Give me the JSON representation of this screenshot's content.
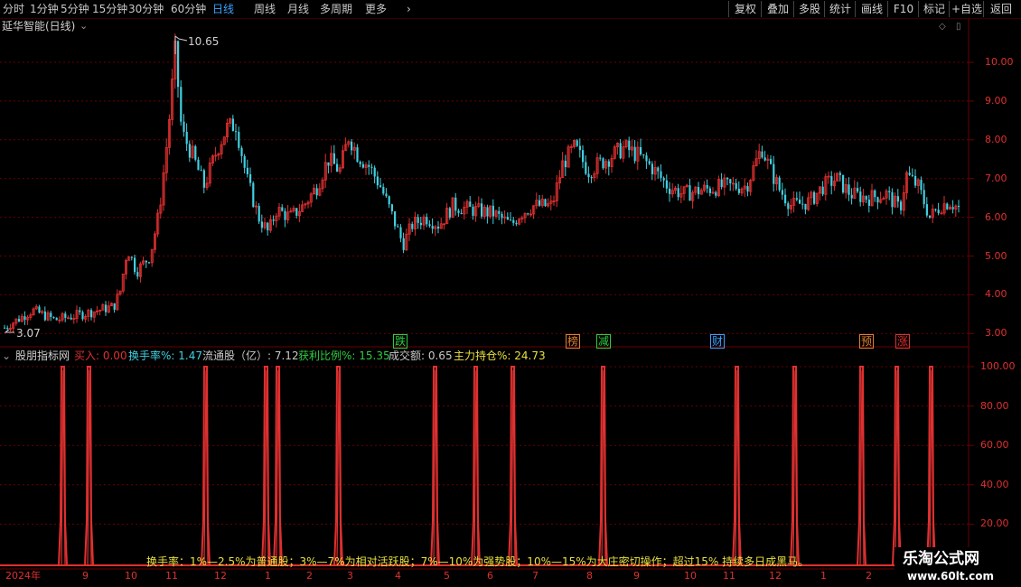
{
  "toolbar": {
    "tabs": [
      {
        "label": "分时",
        "active": false
      },
      {
        "label": "1分钟",
        "active": false
      },
      {
        "label": "5分钟",
        "active": false
      },
      {
        "label": "15分钟",
        "active": false
      },
      {
        "label": "30分钟",
        "active": false
      },
      {
        "label": "60分钟",
        "active": false
      },
      {
        "label": "日线",
        "active": true
      },
      {
        "label": "周线",
        "active": false
      },
      {
        "label": "月线",
        "active": false
      },
      {
        "label": "多周期",
        "active": false
      },
      {
        "label": "更多",
        "active": false
      }
    ],
    "more_arrow": "›",
    "right_buttons": [
      "复权",
      "叠加",
      "多股",
      "统计",
      "画线",
      "F10",
      "标记",
      "+自选",
      "返回"
    ]
  },
  "main_chart": {
    "title": "延华智能(日线)",
    "high_label": "10.65",
    "low_label": "3.07",
    "y_ticks": [
      "10.00",
      "9.00",
      "8.00",
      "7.00",
      "6.00",
      "5.00",
      "4.00",
      "3.00"
    ],
    "signals": [
      {
        "text": "跌",
        "color": "#2ecc40"
      },
      {
        "text": "榜",
        "color": "#e08030"
      },
      {
        "text": "减",
        "color": "#2ecc40"
      },
      {
        "text": "财",
        "color": "#3aa0ff"
      },
      {
        "text": "预",
        "color": "#e08030"
      },
      {
        "text": "涨",
        "color": "#e03030"
      }
    ]
  },
  "indicator": {
    "name": "股朋指标网",
    "items": [
      {
        "label": "买入: ",
        "value": "0.00",
        "color": "#e03030"
      },
      {
        "label": "换手率%: ",
        "value": "1.47",
        "color": "#40d0e0"
      },
      {
        "label": "流通股（亿）: ",
        "value": "7.12",
        "color": "#c8c8c8"
      },
      {
        "label": "获利比例%: ",
        "value": "15.35",
        "color": "#2ecc40"
      },
      {
        "label": "成交额: ",
        "value": "0.65",
        "color": "#c8c8c8"
      },
      {
        "label": "主力持仓%: ",
        "value": "24.73",
        "color": "#e8e040"
      }
    ],
    "y_ticks": [
      "100.00",
      "80.00",
      "60.00",
      "40.00",
      "20.00"
    ],
    "note": "换手率：1%—2.5%为普通股；3%—7%为相对活跃股；7%—10%为强势股；10%—15%为大庄密切操作；超过15% 持续多日成黑马。"
  },
  "x_axis": {
    "labels": [
      "2024年",
      "9",
      "10",
      "11",
      "12",
      "1",
      "2",
      "3",
      "4",
      "5",
      "6",
      "7",
      "8",
      "9",
      "10",
      "11",
      "12",
      "1",
      "2"
    ]
  },
  "watermark": {
    "title": "乐淘公式网",
    "url": "www.60lt.com"
  },
  "colors": {
    "up": "#e03030",
    "down": "#40d0e0",
    "grid": "#6a0000",
    "accent": "#3aa0ff"
  }
}
